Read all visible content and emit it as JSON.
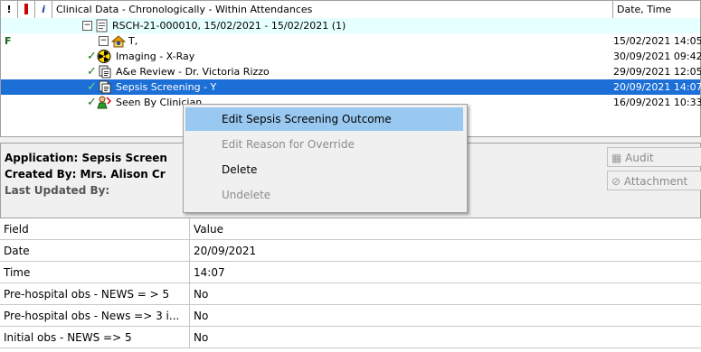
{
  "grid": {
    "header": {
      "col_alert": "!",
      "col_flag": "!",
      "col_info": "i",
      "title": "Clinical Data - Chronologically - Within Attendances",
      "date_col": "Date, Time"
    },
    "attendance": {
      "label": "RSCH-21-000010, 15/02/2021 - 15/02/2021 (1)"
    },
    "patient_row": {
      "sex": "F",
      "label": "T,",
      "date": "15/02/2021 14:05"
    },
    "rows": [
      {
        "label": "Imaging - X-Ray",
        "date": "30/09/2021 09:42",
        "icon": "radiation-icon"
      },
      {
        "label": "A&e Review - Dr. Victoria Rizzo",
        "date": "29/09/2021 12:05",
        "icon": "document-icon"
      },
      {
        "label": "Sepsis Screening - Y",
        "date": "20/09/2021 14:07",
        "icon": "document-icon"
      },
      {
        "label": "Seen By Clinician",
        "date": "16/09/2021 10:33",
        "icon": "clinician-icon"
      }
    ]
  },
  "info": {
    "application": "Application: Sepsis Screen",
    "created_by": "Created By: Mrs. Alison Cr",
    "last_updated": "Last Updated By:",
    "audit_label": "Audit",
    "attachments_label": "Attachment"
  },
  "table": {
    "headers": {
      "field": "Field",
      "value": "Value"
    },
    "rows": [
      {
        "field": "Date",
        "value": "20/09/2021"
      },
      {
        "field": "Time",
        "value": "14:07"
      },
      {
        "field": "Pre-hospital obs - NEWS = > 5",
        "value": "No"
      },
      {
        "field": "Pre-hospital obs - News => 3 i...",
        "value": "No"
      },
      {
        "field": "Initial obs - NEWS => 5",
        "value": "No"
      }
    ]
  },
  "context_menu": {
    "items": [
      {
        "label": "Edit Sepsis Screening Outcome",
        "state": "highlighted"
      },
      {
        "label": "Edit Reason for Override",
        "state": "disabled"
      },
      {
        "label": "Delete",
        "state": "enabled"
      },
      {
        "label": "Undelete",
        "state": "disabled"
      }
    ]
  },
  "colors": {
    "selection": "#1c6fd6",
    "menu_highlight": "#99c9f0",
    "attendance_bg": "#e6ffff",
    "tick": "#1a7a1a"
  }
}
